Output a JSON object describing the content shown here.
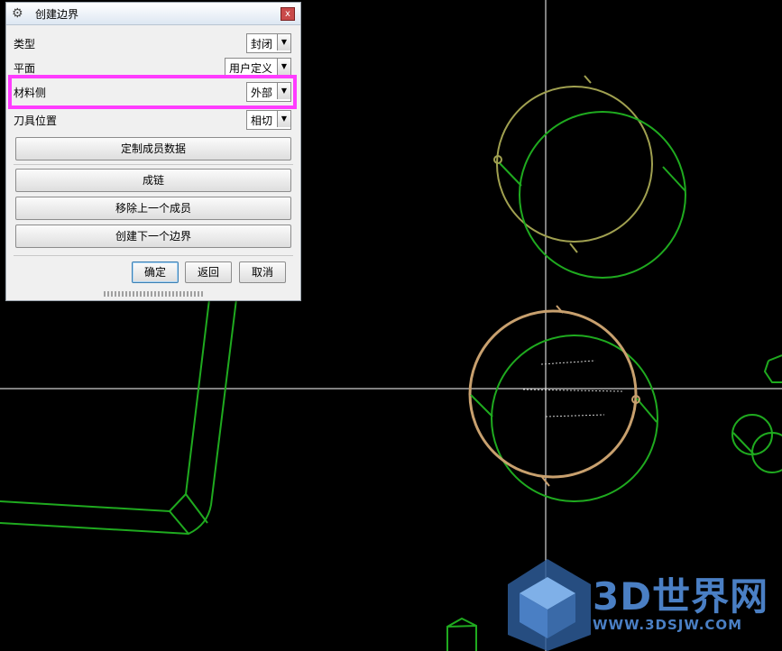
{
  "window": {
    "title": "创建边界",
    "close_glyph": "x",
    "gear_icon": "gear-icon"
  },
  "fields": [
    {
      "label": "类型",
      "value": "封闭"
    },
    {
      "label": "平面",
      "value": "用户定义"
    },
    {
      "label": "材料侧",
      "value": "外部"
    },
    {
      "label": "刀具位置",
      "value": "相切"
    }
  ],
  "buttons": {
    "custom_member_data": "定制成员数据",
    "chain": "成链",
    "remove_last_member": "移除上一个成员",
    "create_next_boundary": "创建下一个边界"
  },
  "footer": {
    "ok": "确定",
    "back": "返回",
    "cancel": "取消"
  },
  "watermark": {
    "text": "3D世界网",
    "sub": "WWW.3DSJW.COM"
  },
  "colors": {
    "highlight": "#ff3cff",
    "geometry": "#1faa1f",
    "circle_tan": "#c8a06e",
    "circle_olive": "#a0a050",
    "crosshair": "#ffffff"
  }
}
